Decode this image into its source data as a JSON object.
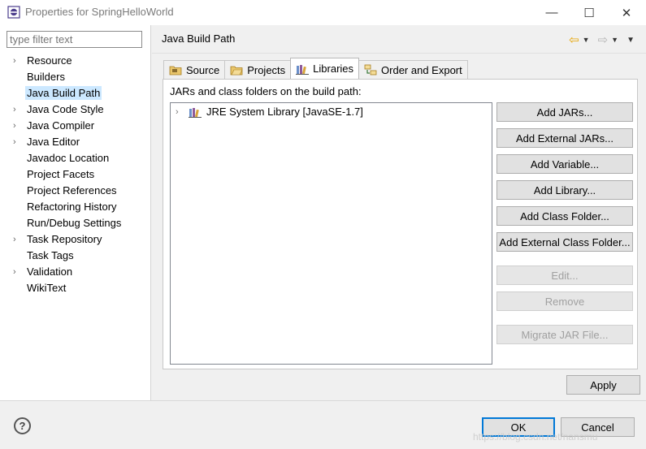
{
  "window": {
    "title": "Properties for SpringHelloWorld",
    "minimize": "—",
    "maximize": "☐",
    "close": "✕"
  },
  "filter": {
    "placeholder": "type filter text"
  },
  "tree": [
    {
      "label": "Resource",
      "expandable": true
    },
    {
      "label": "Builders",
      "expandable": false
    },
    {
      "label": "Java Build Path",
      "expandable": false,
      "selected": true
    },
    {
      "label": "Java Code Style",
      "expandable": true
    },
    {
      "label": "Java Compiler",
      "expandable": true
    },
    {
      "label": "Java Editor",
      "expandable": true
    },
    {
      "label": "Javadoc Location",
      "expandable": false
    },
    {
      "label": "Project Facets",
      "expandable": false
    },
    {
      "label": "Project References",
      "expandable": false
    },
    {
      "label": "Refactoring History",
      "expandable": false
    },
    {
      "label": "Run/Debug Settings",
      "expandable": false
    },
    {
      "label": "Task Repository",
      "expandable": true
    },
    {
      "label": "Task Tags",
      "expandable": false
    },
    {
      "label": "Validation",
      "expandable": true
    },
    {
      "label": "WikiText",
      "expandable": false
    }
  ],
  "page": {
    "title": "Java Build Path"
  },
  "tabs": [
    {
      "label": "Source",
      "icon": "source-folder-icon"
    },
    {
      "label": "Projects",
      "icon": "projects-folder-icon"
    },
    {
      "label": "Libraries",
      "icon": "libraries-icon",
      "active": true
    },
    {
      "label": "Order and Export",
      "icon": "order-export-icon"
    }
  ],
  "libraries": {
    "label": "JARs and class folders on the build path:",
    "entries": [
      {
        "label": "JRE System Library [JavaSE-1.7]"
      }
    ]
  },
  "buttons": {
    "add_jars": "Add JARs...",
    "add_external_jars": "Add External JARs...",
    "add_variable": "Add Variable...",
    "add_library": "Add Library...",
    "add_class_folder": "Add Class Folder...",
    "add_external_class_folder": "Add External Class Folder...",
    "edit": "Edit...",
    "remove": "Remove",
    "migrate_jar": "Migrate JAR File...",
    "apply": "Apply",
    "ok": "OK",
    "cancel": "Cancel",
    "help": "?"
  },
  "watermark": "https://blog.csdn.net/nansmu",
  "colors": {
    "selection": "#cce8ff",
    "accent": "#0078d7",
    "back_arrow": "#e7a400"
  }
}
